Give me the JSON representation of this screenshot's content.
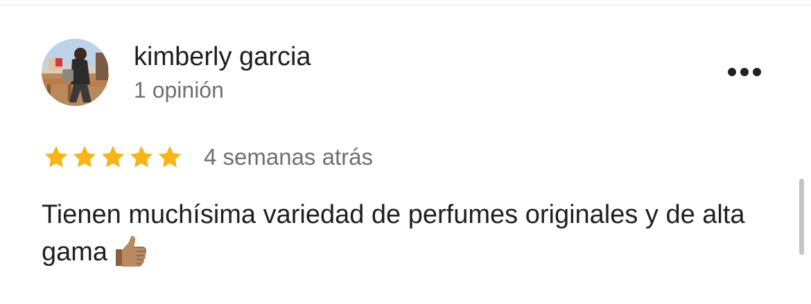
{
  "review": {
    "author_name": "kimberly garcia",
    "review_count": "1 opinión",
    "rating": 5,
    "rating_max": 5,
    "date": "4 semanas atrás",
    "text": "Tienen muchísima variedad de perfumes originales y de alta gama",
    "text_emoji": "thumbs-up"
  },
  "icons": {
    "more": "more-horizontal-icon",
    "star": "star-icon",
    "thumb": "thumbs-up-icon"
  },
  "colors": {
    "star": "#F9B418",
    "text_primary": "#1F1F1F",
    "text_secondary": "#6F6F6F"
  }
}
